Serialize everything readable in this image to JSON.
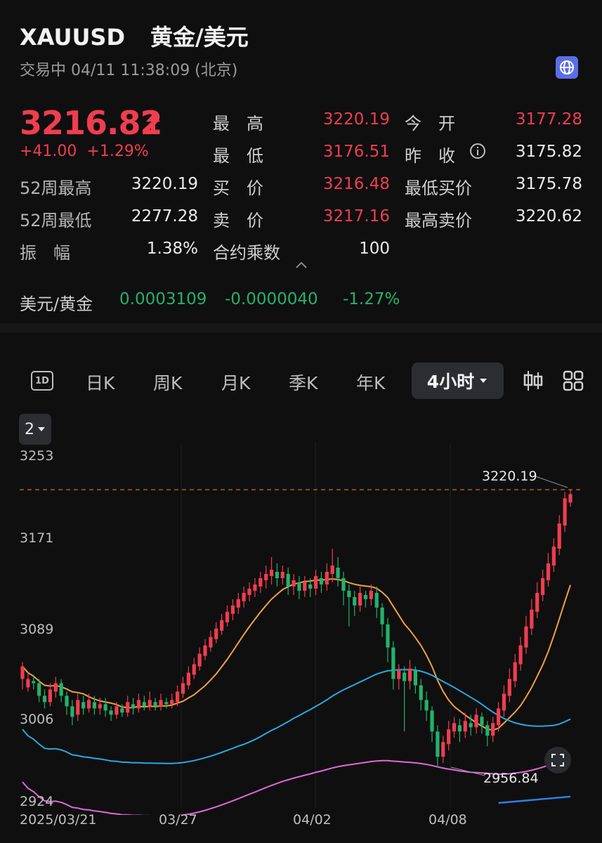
{
  "header": {
    "symbol": "XAUUSD",
    "name": "黄金/美元",
    "status": "交易中 04/11 11:38:09 (北京)"
  },
  "quote": {
    "price": "3216.82",
    "change": "+41.00",
    "change_pct": "+1.29%",
    "rows": [
      {
        "l1": "52周最高",
        "v1": "3220.19",
        "l2": "最　高",
        "v2": "3220.19",
        "l3": "今　开",
        "v3": "3177.28"
      },
      {
        "l1": "52周最低",
        "v1": "2277.28",
        "l2": "最　低",
        "v2": "3176.51",
        "l3": "昨　收",
        "v3": "3175.82"
      },
      {
        "l1": "振　幅",
        "v1": "1.38%",
        "l2": "买　价",
        "v2": "3216.48",
        "l3": "最低买价",
        "v3": "3175.78"
      },
      {
        "l2": "卖　价",
        "v2": "3217.16",
        "l3": "最高卖价",
        "v3": "3220.62"
      },
      {
        "l2": "合约乘数",
        "v2": "100"
      }
    ]
  },
  "inverse": {
    "label": "美元/黄金",
    "value": "0.0003109",
    "change": "-0.0000040",
    "change_pct": "-1.27%"
  },
  "tabs": {
    "intraday": "1D",
    "day": "日K",
    "week": "周K",
    "month": "月K",
    "quarter": "季K",
    "year": "年K",
    "active": "4小时"
  },
  "indicator_selector": "2",
  "colors": {
    "up": "#ef3e4e",
    "down": "#23b26b",
    "ma1": "#f0a040",
    "ma2": "#29a9e0",
    "ma3": "#e06ad8",
    "ma4": "#2f7ee6",
    "td_up": "#e040e8",
    "td_down": "#3fc84a"
  },
  "chart_data": {
    "type": "candlestick",
    "y_ticks": [
      "3253",
      "3171",
      "3089",
      "3006",
      "2924"
    ],
    "x_ticks": [
      "2025/03/21",
      "03/27",
      "04/02",
      "04/08"
    ],
    "high_marker": "3220.19",
    "low_marker": "2956.84",
    "ylim": [
      2924,
      3253
    ],
    "candles": [
      [
        3040,
        3052,
        3030,
        3056
      ],
      [
        3032,
        3040,
        3028,
        3046
      ],
      [
        3038,
        3036,
        3030,
        3044
      ],
      [
        3036,
        3024,
        3018,
        3040
      ],
      [
        3024,
        3018,
        3012,
        3030
      ],
      [
        3018,
        3030,
        3014,
        3036
      ],
      [
        3028,
        3036,
        3022,
        3042
      ],
      [
        3036,
        3024,
        3018,
        3040
      ],
      [
        3024,
        3014,
        3006,
        3028
      ],
      [
        3014,
        3004,
        2996,
        3020
      ],
      [
        3006,
        3020,
        3000,
        3026
      ],
      [
        3018,
        3012,
        3006,
        3024
      ],
      [
        3012,
        3020,
        3008,
        3026
      ],
      [
        3018,
        3012,
        3006,
        3024
      ],
      [
        3012,
        3016,
        3006,
        3022
      ],
      [
        3016,
        3010,
        3004,
        3022
      ],
      [
        3010,
        3006,
        3000,
        3014
      ],
      [
        3006,
        3014,
        3002,
        3018
      ],
      [
        3012,
        3008,
        3004,
        3016
      ],
      [
        3008,
        3018,
        3004,
        3024
      ],
      [
        3016,
        3012,
        3006,
        3022
      ],
      [
        3012,
        3020,
        3008,
        3026
      ],
      [
        3018,
        3014,
        3010,
        3024
      ],
      [
        3014,
        3020,
        3010,
        3028
      ],
      [
        3018,
        3014,
        3010,
        3022
      ],
      [
        3014,
        3020,
        3010,
        3026
      ],
      [
        3018,
        3016,
        3012,
        3022
      ],
      [
        3016,
        3020,
        3012,
        3026
      ],
      [
        3018,
        3028,
        3014,
        3034
      ],
      [
        3026,
        3036,
        3022,
        3042
      ],
      [
        3034,
        3046,
        3030,
        3052
      ],
      [
        3044,
        3054,
        3040,
        3060
      ],
      [
        3052,
        3064,
        3048,
        3070
      ],
      [
        3062,
        3072,
        3058,
        3078
      ],
      [
        3070,
        3080,
        3066,
        3086
      ],
      [
        3078,
        3088,
        3074,
        3094
      ],
      [
        3086,
        3096,
        3082,
        3102
      ],
      [
        3094,
        3104,
        3090,
        3110
      ],
      [
        3102,
        3110,
        3096,
        3116
      ],
      [
        3108,
        3116,
        3102,
        3122
      ],
      [
        3114,
        3122,
        3108,
        3128
      ],
      [
        3120,
        3126,
        3114,
        3132
      ],
      [
        3124,
        3130,
        3118,
        3136
      ],
      [
        3128,
        3136,
        3122,
        3142
      ],
      [
        3134,
        3140,
        3126,
        3148
      ],
      [
        3138,
        3144,
        3130,
        3156
      ],
      [
        3142,
        3136,
        3128,
        3150
      ],
      [
        3136,
        3142,
        3130,
        3148
      ],
      [
        3140,
        3128,
        3120,
        3146
      ],
      [
        3128,
        3134,
        3120,
        3140
      ],
      [
        3132,
        3124,
        3116,
        3138
      ],
      [
        3124,
        3132,
        3118,
        3138
      ],
      [
        3130,
        3126,
        3118,
        3136
      ],
      [
        3126,
        3138,
        3120,
        3144
      ],
      [
        3136,
        3130,
        3122,
        3142
      ],
      [
        3130,
        3142,
        3124,
        3150
      ],
      [
        3140,
        3148,
        3132,
        3164
      ],
      [
        3146,
        3136,
        3128,
        3156
      ],
      [
        3136,
        3124,
        3110,
        3142
      ],
      [
        3124,
        3118,
        3090,
        3130
      ],
      [
        3118,
        3110,
        3100,
        3124
      ],
      [
        3110,
        3122,
        3104,
        3128
      ],
      [
        3120,
        3116,
        3108,
        3124
      ],
      [
        3116,
        3124,
        3110,
        3130
      ],
      [
        3122,
        3108,
        3098,
        3128
      ],
      [
        3108,
        3092,
        3080,
        3112
      ],
      [
        3092,
        3070,
        3056,
        3098
      ],
      [
        3070,
        3040,
        3030,
        3076
      ],
      [
        3040,
        3048,
        3030,
        3054
      ],
      [
        3046,
        3038,
        2990,
        3052
      ],
      [
        3038,
        3050,
        3030,
        3058
      ],
      [
        3048,
        3034,
        3026,
        3052
      ],
      [
        3034,
        3020,
        3010,
        3040
      ],
      [
        3020,
        3010,
        3000,
        3028
      ],
      [
        3010,
        2990,
        2980,
        3014
      ],
      [
        2990,
        2966,
        2956,
        2996
      ],
      [
        2966,
        2980,
        2960,
        2986
      ],
      [
        2978,
        2992,
        2972,
        3000
      ],
      [
        2990,
        2998,
        2984,
        3004
      ],
      [
        2996,
        2990,
        2980,
        3002
      ],
      [
        2990,
        3000,
        2984,
        3008
      ],
      [
        2998,
        2994,
        2986,
        3006
      ],
      [
        2994,
        3006,
        2988,
        3012
      ],
      [
        3004,
        2996,
        2988,
        3008
      ],
      [
        2996,
        2986,
        2976,
        3000
      ],
      [
        2986,
        2998,
        2980,
        3004
      ],
      [
        2996,
        3012,
        2990,
        3018
      ],
      [
        3010,
        3026,
        3004,
        3034
      ],
      [
        3024,
        3040,
        3018,
        3050
      ],
      [
        3038,
        3056,
        3032,
        3064
      ],
      [
        3054,
        3072,
        3048,
        3080
      ],
      [
        3070,
        3090,
        3064,
        3100
      ],
      [
        3088,
        3106,
        3082,
        3116
      ],
      [
        3104,
        3122,
        3098,
        3132
      ],
      [
        3120,
        3136,
        3114,
        3144
      ],
      [
        3134,
        3150,
        3128,
        3160
      ],
      [
        3148,
        3166,
        3142,
        3174
      ],
      [
        3164,
        3188,
        3158,
        3196
      ],
      [
        3186,
        3212,
        3180,
        3218
      ],
      [
        3208,
        3216,
        3204,
        3220
      ]
    ]
  }
}
